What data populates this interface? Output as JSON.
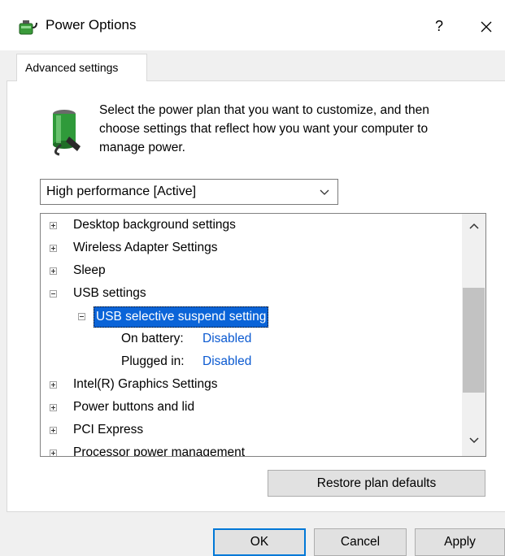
{
  "window": {
    "title": "Power Options",
    "help_label": "?",
    "close_label": "✕",
    "icon": "power-options-icon"
  },
  "tab": {
    "label": "Advanced settings"
  },
  "description": "Select the power plan that you want to customize, and then choose settings that reflect how you want your computer to manage power.",
  "plan_select": {
    "value": "High performance [Active]"
  },
  "tree": {
    "items": [
      {
        "label": "Desktop background settings",
        "expander": "plus"
      },
      {
        "label": "Wireless Adapter Settings",
        "expander": "plus"
      },
      {
        "label": "Sleep",
        "expander": "plus"
      },
      {
        "label": "USB settings",
        "expander": "minus"
      },
      {
        "label": "USB selective suspend setting",
        "expander": "minus",
        "selected": true
      },
      {
        "label": "On battery:",
        "value": "Disabled"
      },
      {
        "label": "Plugged in:",
        "value": "Disabled"
      },
      {
        "label": "Intel(R) Graphics Settings",
        "expander": "plus"
      },
      {
        "label": "Power buttons and lid",
        "expander": "plus"
      },
      {
        "label": "PCI Express",
        "expander": "plus"
      },
      {
        "label": "Processor power management",
        "expander": "plus"
      }
    ]
  },
  "buttons": {
    "restore": "Restore plan defaults",
    "ok": "OK",
    "cancel": "Cancel",
    "apply": "Apply"
  },
  "colors": {
    "selection": "#0a64d8",
    "link": "#0b5ad1",
    "default_button_border": "#0078d7"
  }
}
